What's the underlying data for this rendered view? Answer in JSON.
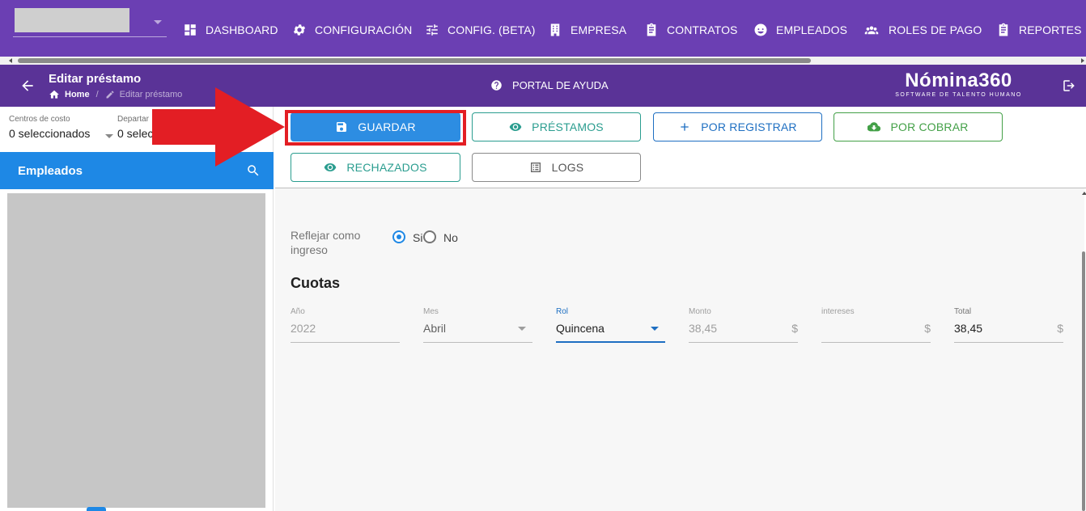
{
  "nav": {
    "items": [
      {
        "label": "DASHBOARD",
        "icon": "dashboard-icon"
      },
      {
        "label": "CONFIGURACIÓN",
        "icon": "gear-icon"
      },
      {
        "label": "CONFIG. (BETA)",
        "icon": "tune-icon"
      },
      {
        "label": "EMPRESA",
        "icon": "building-icon"
      },
      {
        "label": "CONTRATOS",
        "icon": "clipboard-icon"
      },
      {
        "label": "EMPLEADOS",
        "icon": "face-icon"
      },
      {
        "label": "ROLES DE PAGO",
        "icon": "people-icon"
      },
      {
        "label": "REPORTES",
        "icon": "report-icon"
      }
    ],
    "bg_color": "#6b3fb3"
  },
  "header": {
    "title": "Editar préstamo",
    "breadcrumb_home": "Home",
    "breadcrumb_current": "Editar préstamo",
    "help_label": "PORTAL DE AYUDA",
    "brand_name": "Nómina360",
    "brand_tagline": "SOFTWARE DE TALENTO HUMANO"
  },
  "filters": {
    "cost_centers_label": "Centros de costo",
    "cost_centers_value": "0 seleccionados",
    "departments_label": "Departar",
    "departments_value": "0 selec"
  },
  "employees": {
    "title": "Empleados"
  },
  "actions": {
    "guardar": "GUARDAR",
    "prestamos": "PRÉSTAMOS",
    "por_registrar": "POR REGISTRAR",
    "por_cobrar": "POR COBRAR",
    "rechazados": "RECHAZADOS",
    "logs": "LOGS"
  },
  "form": {
    "reflect_label": "Reflejar como ingreso",
    "option_yes": "Si",
    "option_no": "No",
    "selected_option": "Si",
    "section_title": "Cuotas",
    "fields": {
      "anio": {
        "label": "Año",
        "value": "2022"
      },
      "mes": {
        "label": "Mes",
        "value": "Abril"
      },
      "rol": {
        "label": "Rol",
        "value": "Quincena"
      },
      "monto": {
        "label": "Monto",
        "value": "38,45",
        "suffix": "$"
      },
      "intereses": {
        "label": "intereses",
        "value": "",
        "suffix": "$"
      },
      "total": {
        "label": "Total",
        "value": "38,45",
        "suffix": "$"
      }
    }
  },
  "colors": {
    "primary": "#2d8de2",
    "title_bar": "#5a3397",
    "annotation": "#e31e24"
  }
}
